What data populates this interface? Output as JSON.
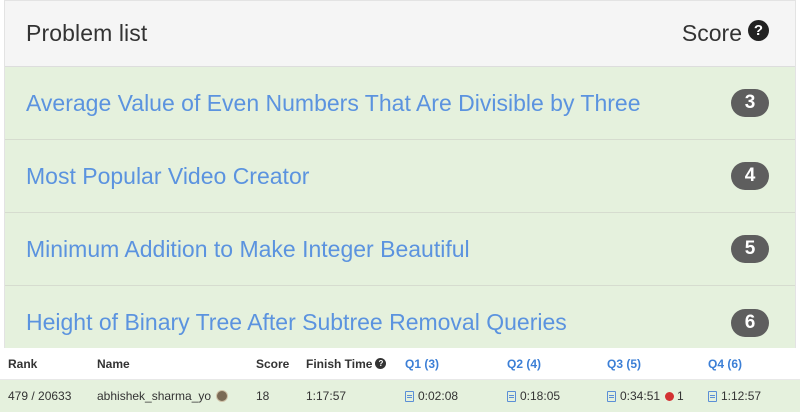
{
  "panel": {
    "title": "Problem list",
    "score_label": "Score",
    "help_glyph": "?"
  },
  "problems": [
    {
      "title": "Average Value of Even Numbers That Are Divisible by Three",
      "score": "3"
    },
    {
      "title": "Most Popular Video Creator",
      "score": "4"
    },
    {
      "title": "Minimum Addition to Make Integer Beautiful",
      "score": "5"
    },
    {
      "title": "Height of Binary Tree After Subtree Removal Queries",
      "score": "6"
    }
  ],
  "ranking": {
    "headers": {
      "rank": "Rank",
      "name": "Name",
      "score": "Score",
      "finish": "Finish Time",
      "q1": "Q1 (3)",
      "q2": "Q2 (4)",
      "q3": "Q3 (5)",
      "q4": "Q4 (6)"
    },
    "row": {
      "rank": "479 / 20633",
      "name": "abhishek_sharma_yo",
      "score": "18",
      "finish": "1:17:57",
      "q1": "0:02:08",
      "q2": "0:18:05",
      "q3": "0:34:51",
      "q3_penalty": "1",
      "q4": "1:12:57"
    }
  },
  "colors": {
    "accent_link": "#5b93df",
    "row_background": "#e5f1dd",
    "badge": "#5e5e5e"
  }
}
